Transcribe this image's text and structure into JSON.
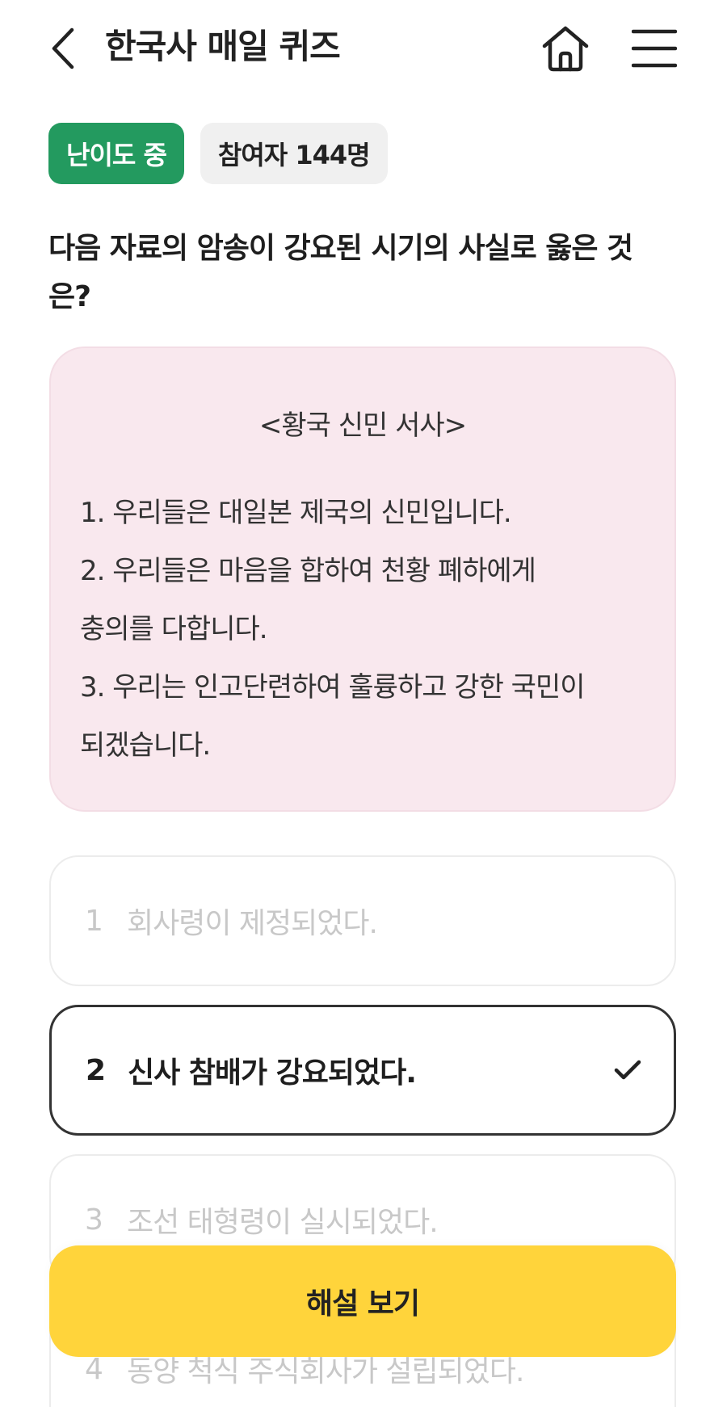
{
  "header": {
    "title": "한국사 매일 퀴즈",
    "back_icon": "chevron-left-icon",
    "home_icon": "home-icon",
    "menu_icon": "hamburger-menu-icon"
  },
  "badges": {
    "level": "난이도 중",
    "participants": "참여자 144명"
  },
  "question": {
    "text": "다음 자료의 암송이 강요된 시기의 사실로 옳은 것은?"
  },
  "source": {
    "title": "<황국 신민 서사>",
    "lines": [
      "1. 우리들은 대일본 제국의 신민입니다.",
      "2. 우리들은 마음을 합하여 천황 폐하에게",
      "충의를 다합니다.",
      "3. 우리는 인고단련하여 훌륭하고 강한 국민이",
      "되겠습니다."
    ]
  },
  "options": [
    {
      "num": "1",
      "text": "회사령이 제정되었다."
    },
    {
      "num": "2",
      "text": "신사 참배가 강요되었다."
    },
    {
      "num": "3",
      "text": "조선 태형령이 실시되었다."
    },
    {
      "num": "4",
      "text": "동양 척식 주식회사가 설립되었다."
    }
  ],
  "cta": {
    "label": "해설 보기"
  },
  "colors": {
    "accent_green": "#239a5f",
    "source_bg": "#f9e8ee",
    "cta_yellow": "#ffd43b"
  }
}
